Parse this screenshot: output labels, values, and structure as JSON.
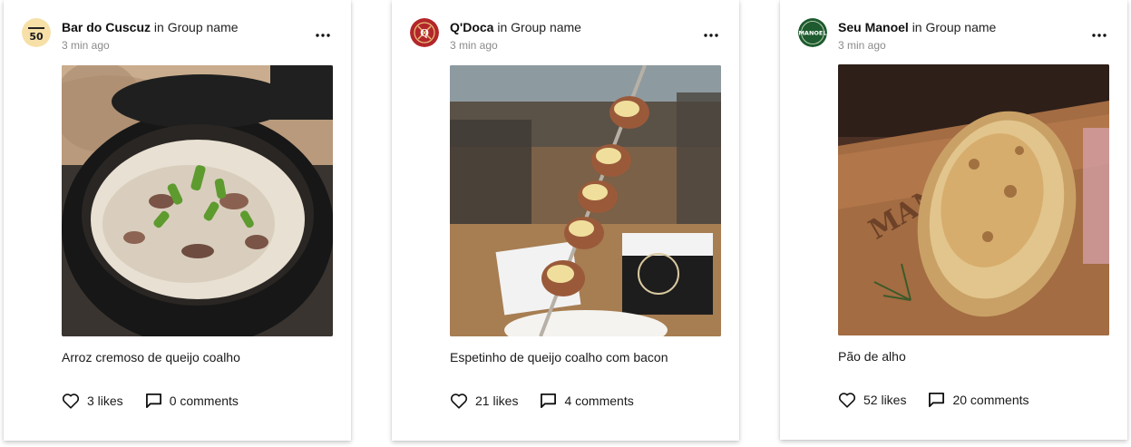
{
  "posts": [
    {
      "author": "Bar do Cuscuz",
      "in_text": "in",
      "group": "Group name",
      "time": "3 min ago",
      "avatar_icon": "bar-do-cuscuz-logo",
      "avatar_logo_text": "50",
      "photo": "clay-pot-creamy-rice",
      "caption": "Arroz cremoso de queijo coalho",
      "likes": "3 likes",
      "comments": "0 comments"
    },
    {
      "author": "Q'Doca",
      "in_text": "in",
      "group": "Group name",
      "time": "3 min ago",
      "avatar_icon": "qdoca-logo",
      "avatar_logo_text": "Q",
      "photo": "cheese-bacon-skewer",
      "caption": "Espetinho de queijo coalho com bacon",
      "likes": "21 likes",
      "comments": "4 comments"
    },
    {
      "author": "Seu Manoel",
      "in_text": "in",
      "group": "Group name",
      "time": "3 min ago",
      "avatar_icon": "seu-manoel-logo",
      "avatar_logo_text": "MANOEL",
      "photo": "garlic-bread-board",
      "caption": "Pão de alho",
      "likes": "52 likes",
      "comments": "20 comments"
    }
  ],
  "icons": {
    "more": "more-horizontal-icon",
    "like": "heart-icon",
    "comment": "comment-icon"
  },
  "colors": {
    "text": "#1a1a1a",
    "muted": "#8a8a8a",
    "qdoca_red": "#b3262a",
    "manoel_green": "#1e5b2e",
    "cuscuz_yellow": "#f6e0a8"
  }
}
